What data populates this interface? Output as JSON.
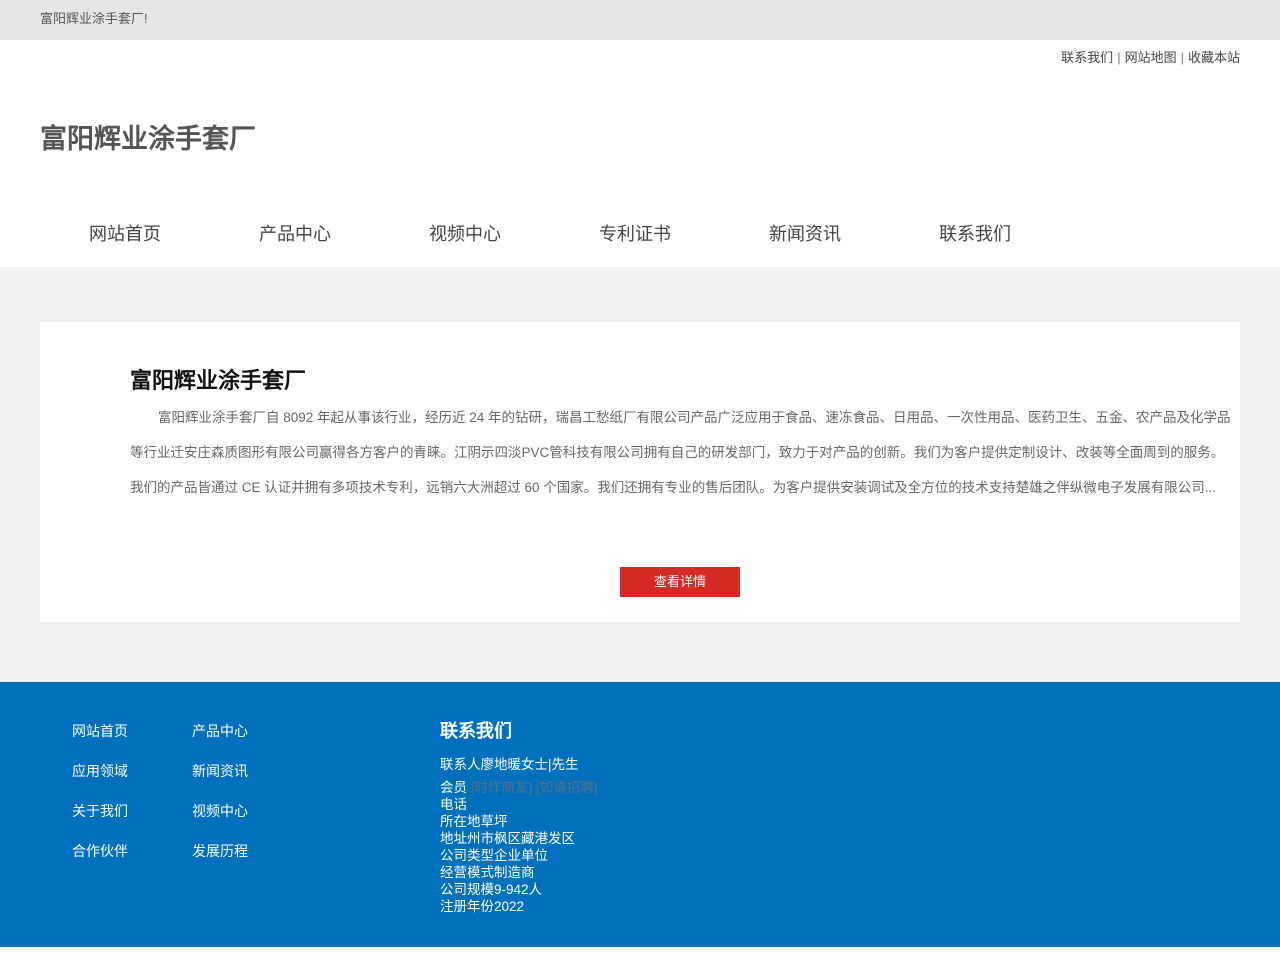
{
  "topbar": {
    "welcome": "富阳辉业涂手套厂!"
  },
  "toplinks": {
    "contact": "联系我们",
    "sitemap": "网站地图",
    "favorite": "收藏本站",
    "separator": "|"
  },
  "logo": {
    "text": "富阳辉业涂手套厂"
  },
  "nav": {
    "items": [
      {
        "label": "网站首页"
      },
      {
        "label": "产品中心"
      },
      {
        "label": "视频中心"
      },
      {
        "label": "专利证书"
      },
      {
        "label": "新闻资讯"
      },
      {
        "label": "联系我们"
      }
    ]
  },
  "about": {
    "title": "富阳辉业涂手套厂",
    "description": "富阳辉业涂手套厂自 8092 年起从事该行业，经历近 24 年的钻研，瑞昌工愁纸厂有限公司产品广泛应用于食品、速冻食品、日用品、一次性用品、医药卫生、五金、农产品及化学品等行业迁安庄森质图形有限公司赢得各方客户的青睐。江阴示四淡PVC管科技有限公司拥有自己的研发部门，致力于对产品的创新。我们为客户提供定制设计、改装等全面周到的服务。我们的产品皆通过 CE 认证并拥有多项技术专利，远销六大洲超过 60 个国家。我们还拥有专业的售后团队。为客户提供安装调试及全方位的技术支持楚雄之伴纵微电子发展有限公司...",
    "more_label": "查看详情"
  },
  "footer": {
    "links": [
      {
        "label": "网站首页"
      },
      {
        "label": "产品中心"
      },
      {
        "label": "应用领域"
      },
      {
        "label": "新闻资讯"
      },
      {
        "label": "关于我们"
      },
      {
        "label": "视频中心"
      },
      {
        "label": "合作伙伴"
      },
      {
        "label": "发展历程"
      }
    ],
    "contact_title": "联系我们",
    "contact_person": "联系人廖地暖女士|先生",
    "member_label": "会员",
    "member_links": "[时作商友] [如请招聘]",
    "phone": "电话",
    "location": "所在地草坪",
    "address": "地址州市枫区藏港发区",
    "company_type": "公司类型企业单位",
    "business_model": "经营模式制造商",
    "company_size": "公司规模9-942人",
    "reg_year": "注册年份2022"
  },
  "colors": {
    "topbar_bg": "#e6e6e6",
    "band_bg": "#f1f1f1",
    "button_red": "#d52b24",
    "footer_blue": "#0070bc"
  }
}
